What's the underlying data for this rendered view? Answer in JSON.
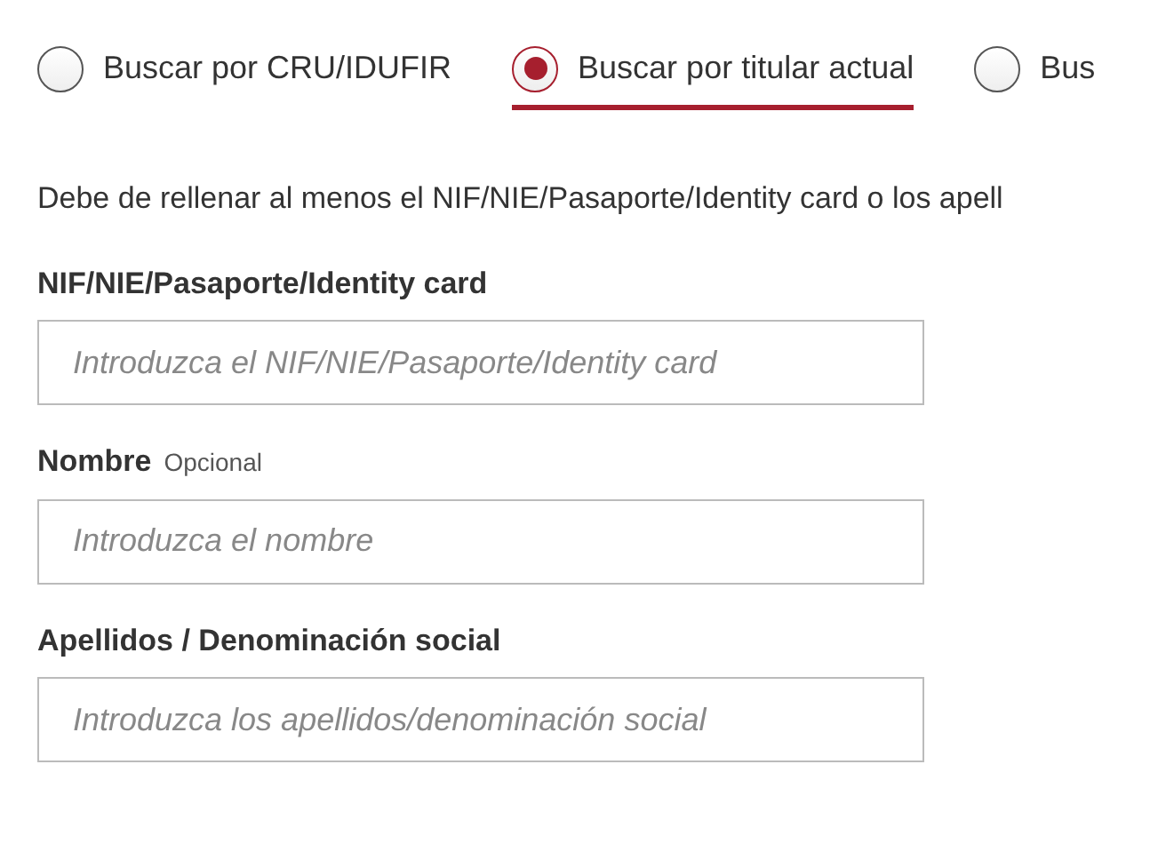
{
  "search_modes": [
    {
      "label": "Buscar por CRU/IDUFIR",
      "selected": false
    },
    {
      "label": "Buscar por titular actual",
      "selected": true
    },
    {
      "label": "Bus",
      "selected": false
    }
  ],
  "instruction": "Debe de rellenar al menos el NIF/NIE/Pasaporte/Identity card o los apell",
  "fields": [
    {
      "label": "NIF/NIE/Pasaporte/Identity card",
      "placeholder": "Introduzca el NIF/NIE/Pasaporte/Identity card"
    },
    {
      "label": "Nombre",
      "hint": "Opcional",
      "placeholder": "Introduzca el nombre"
    },
    {
      "label": "Apellidos / Denominación social",
      "placeholder": "Introduzca los apellidos/denominación social"
    }
  ]
}
